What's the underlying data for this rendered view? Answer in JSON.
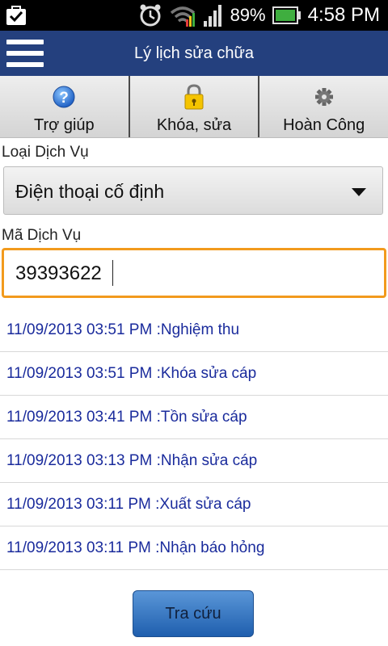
{
  "status_bar": {
    "battery": "89%",
    "time": "4:58 PM",
    "icons": [
      "checkbox-bag-icon",
      "alarm-clock-icon",
      "wifi-icon",
      "signal-icon",
      "battery-icon"
    ]
  },
  "title_bar": {
    "title": "Lý lịch sửa chữa",
    "menu_icon": "hamburger-menu-icon"
  },
  "toolbar": {
    "items": [
      {
        "label": "Trợ giúp",
        "icon": "help-icon"
      },
      {
        "label": "Khóa, sửa",
        "icon": "lock-icon"
      },
      {
        "label": "Hoàn Công",
        "icon": "gear-icon"
      }
    ]
  },
  "form": {
    "service_type_label": "Loại Dịch Vụ",
    "service_type_value": "Điện thoại cố định",
    "service_code_label": "Mã Dịch Vụ",
    "service_code_value": "39393622"
  },
  "history": [
    {
      "text": "11/09/2013 03:51 PM :Nghiệm thu"
    },
    {
      "text": "11/09/2013 03:51 PM :Khóa sửa cáp"
    },
    {
      "text": "11/09/2013 03:41 PM :Tồn sửa cáp"
    },
    {
      "text": "11/09/2013 03:13 PM :Nhận sửa cáp"
    },
    {
      "text": "11/09/2013 03:11 PM :Xuất sửa cáp"
    },
    {
      "text": "11/09/2013 03:11 PM :Nhận báo hỏng"
    }
  ],
  "search_button": {
    "label": "Tra cứu"
  },
  "colors": {
    "title_bar": "#24407e",
    "history_text": "#1a2b9c",
    "input_border": "#f29a1d",
    "button": "#3a7cc6"
  }
}
